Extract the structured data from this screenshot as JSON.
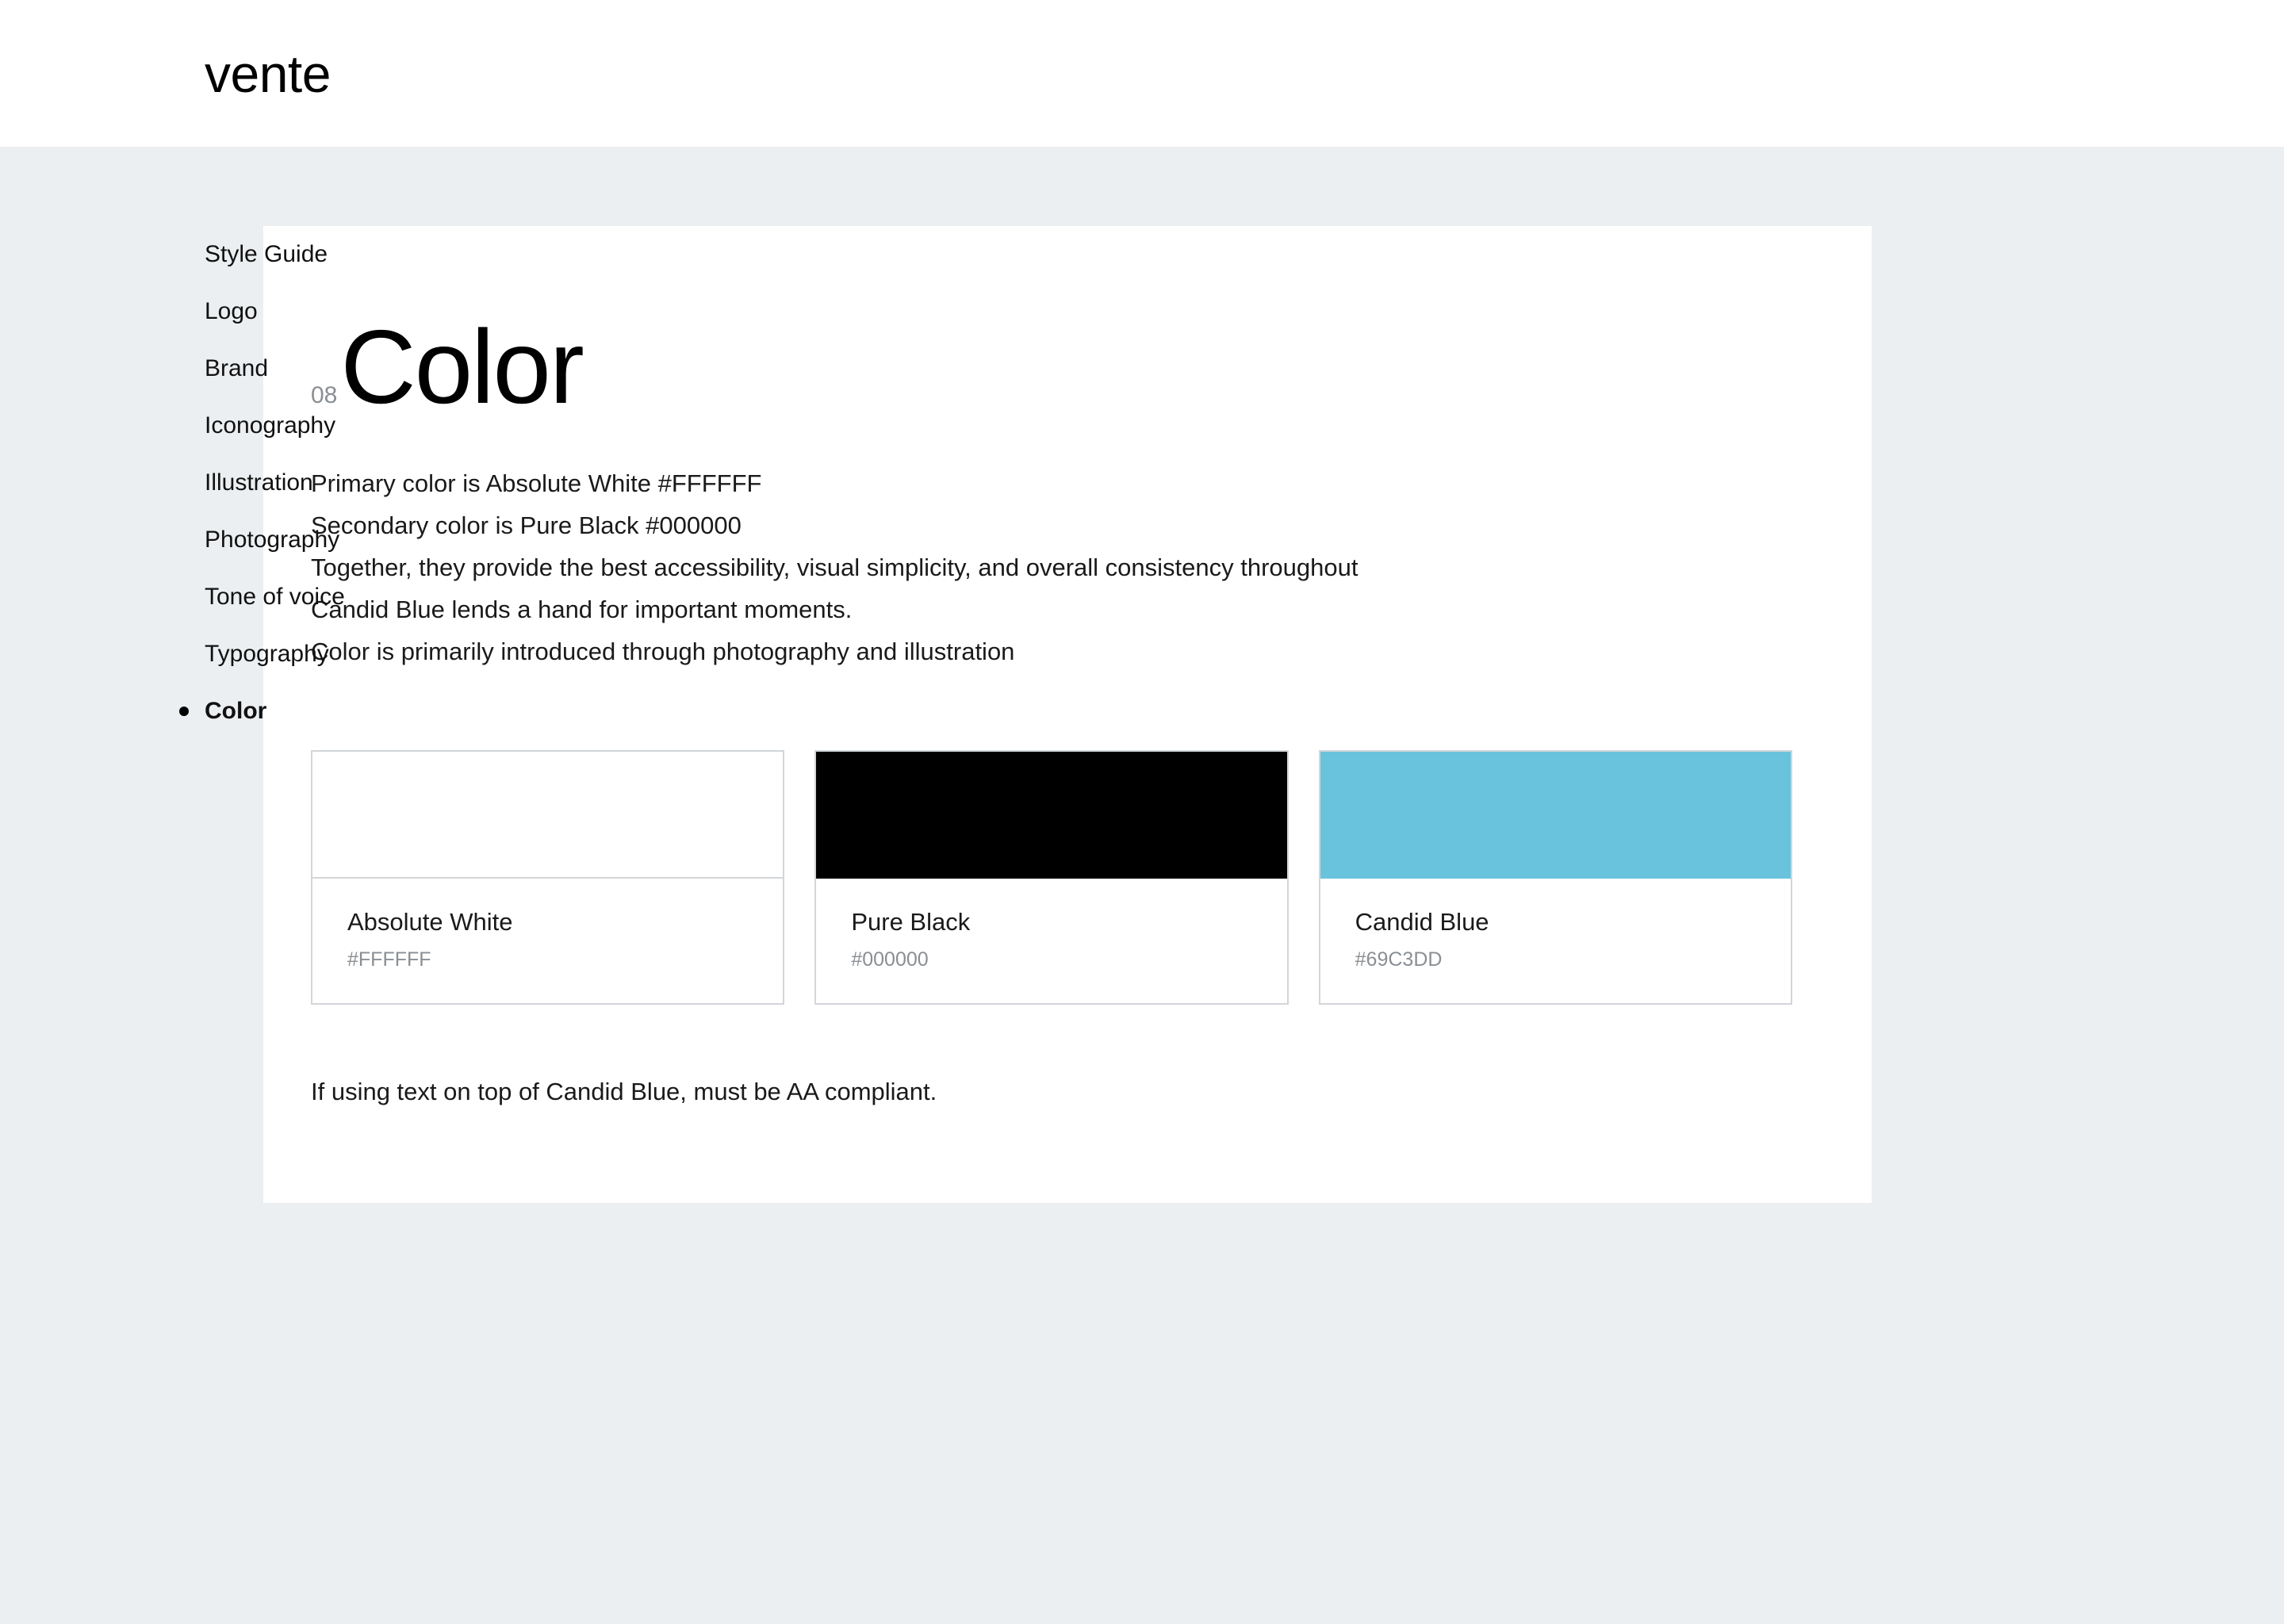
{
  "header": {
    "brand": "vente"
  },
  "sidebar": {
    "items": [
      {
        "label": "Style Guide",
        "active": false
      },
      {
        "label": "Logo",
        "active": false
      },
      {
        "label": "Brand",
        "active": false
      },
      {
        "label": "Iconography",
        "active": false
      },
      {
        "label": "Illustration",
        "active": false
      },
      {
        "label": "Photography",
        "active": false
      },
      {
        "label": "Tone of voice",
        "active": false
      },
      {
        "label": "Typography",
        "active": false
      },
      {
        "label": "Color",
        "active": true
      }
    ]
  },
  "main": {
    "section_number": "08",
    "section_title": "Color",
    "body_lines": [
      "Primary color is Absolute White #FFFFFF",
      "Secondary color is Pure Black #000000",
      "Together, they provide the best accessibility, visual simplicity, and overall consistency throughout",
      "Candid Blue lends a hand for important moments.",
      "Color is primarily introduced through photography and illustration"
    ],
    "swatches": [
      {
        "name": "Absolute White",
        "hex": "#FFFFFF",
        "chip_color": "#FFFFFF",
        "chip_needs_divider": true
      },
      {
        "name": "Pure Black",
        "hex": "#000000",
        "chip_color": "#000000",
        "chip_needs_divider": false
      },
      {
        "name": "Candid Blue",
        "hex": "#69C3DD",
        "chip_color": "#69C3DD",
        "chip_needs_divider": false
      }
    ],
    "footnote": "If using text on top of Candid Blue, must be AA compliant."
  },
  "theme": {
    "page_background": "#ECEFF1",
    "card_background": "#FFFFFF",
    "border_color": "#D2D6D9",
    "muted_text": "#8A8F94",
    "accent": "#69C3DD"
  }
}
